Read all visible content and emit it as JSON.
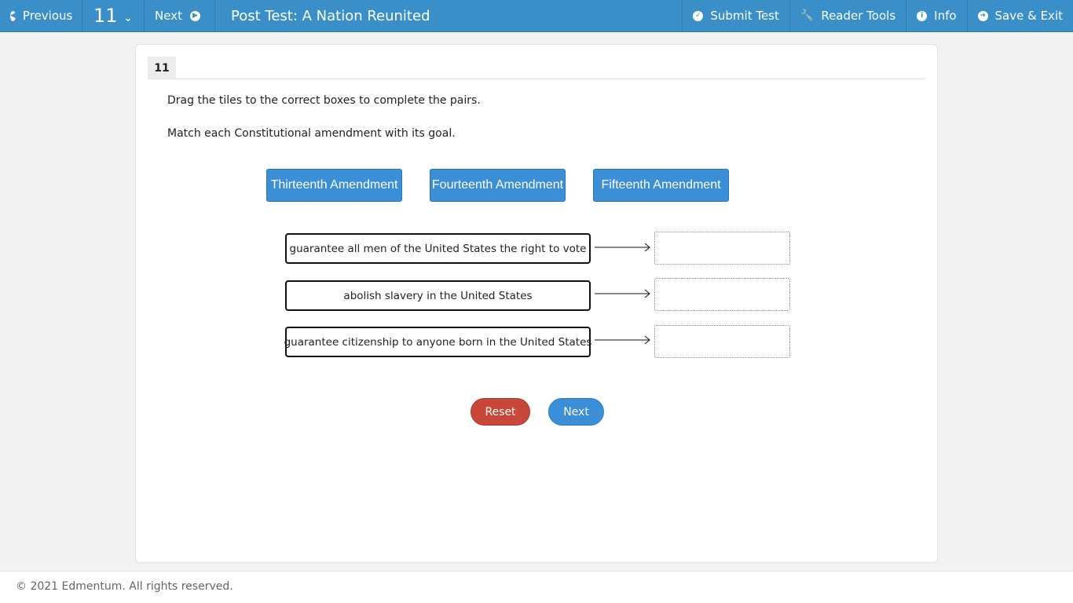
{
  "topbar": {
    "previous_label": "Previous",
    "question_number": "11",
    "next_label": "Next",
    "title": "Post Test: A Nation Reunited",
    "submit_label": "Submit Test",
    "reader_tools_label": "Reader Tools",
    "info_label": "Info",
    "save_exit_label": "Save & Exit"
  },
  "question": {
    "number": "11",
    "instruction": "Drag the tiles to the correct boxes to complete the pairs.",
    "prompt": "Match each Constitutional amendment with its goal.",
    "tiles": [
      "Thirteenth Amendment",
      "Fourteenth Amendment",
      "Fifteenth Amendment"
    ],
    "pairs": [
      "guarantee all men of the United States the right to vote",
      "abolish slavery in the United States",
      "guarantee citizenship to anyone born in the United States"
    ],
    "reset_label": "Reset",
    "next_label": "Next"
  },
  "footer": {
    "copyright": "© 2021 Edmentum. All rights reserved."
  },
  "colors": {
    "topbar": "#3a8fc9",
    "tile": "#3a8fd6",
    "reset": "#c9473a"
  }
}
